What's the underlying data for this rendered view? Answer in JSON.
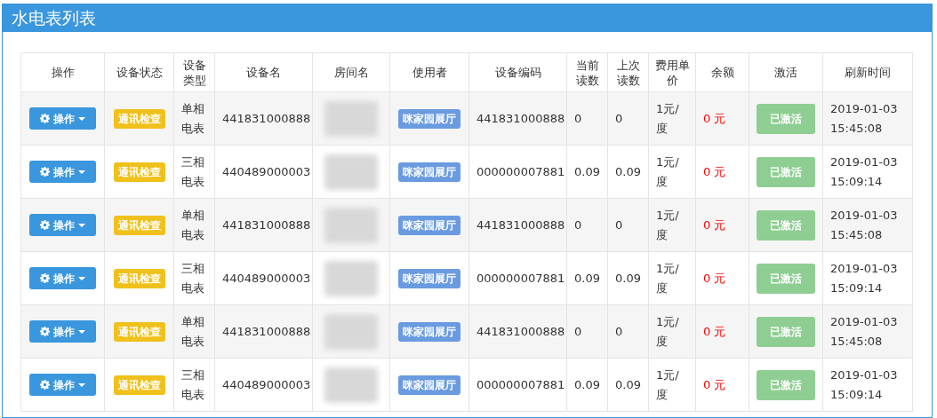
{
  "panel": {
    "title": "水电表列表"
  },
  "table": {
    "columns": [
      "操作",
      "设备状态",
      "设备类型",
      "设备名",
      "房间名",
      "使用者",
      "设备编码",
      "当前读数",
      "上次读数",
      "费用单价",
      "余额",
      "激活",
      "刷新时间"
    ],
    "rows": [
      {
        "action": "操作",
        "status": "通讯检查",
        "type": "单相电表",
        "device_name": "441831000888",
        "user": "咪家园展厅",
        "code": "441831000888",
        "current": "0",
        "previous": "0",
        "price": "1元/度",
        "balance": "0 元",
        "activate": "已激活",
        "refreshed": "2019-01-03 15:45:08"
      },
      {
        "action": "操作",
        "status": "通讯检查",
        "type": "三相电表",
        "device_name": "440489000003",
        "user": "咪家园展厅",
        "code": "000000007881",
        "current": "0.09",
        "previous": "0.09",
        "price": "1元/度",
        "balance": "0 元",
        "activate": "已激活",
        "refreshed": "2019-01-03 15:09:14"
      },
      {
        "action": "操作",
        "status": "通讯检查",
        "type": "单相电表",
        "device_name": "441831000888",
        "user": "咪家园展厅",
        "code": "441831000888",
        "current": "0",
        "previous": "0",
        "price": "1元/度",
        "balance": "0 元",
        "activate": "已激活",
        "refreshed": "2019-01-03 15:45:08"
      },
      {
        "action": "操作",
        "status": "通讯检查",
        "type": "三相电表",
        "device_name": "440489000003",
        "user": "咪家园展厅",
        "code": "000000007881",
        "current": "0.09",
        "previous": "0.09",
        "price": "1元/度",
        "balance": "0 元",
        "activate": "已激活",
        "refreshed": "2019-01-03 15:09:14"
      },
      {
        "action": "操作",
        "status": "通讯检查",
        "type": "单相电表",
        "device_name": "441831000888",
        "user": "咪家园展厅",
        "code": "441831000888",
        "current": "0",
        "previous": "0",
        "price": "1元/度",
        "balance": "0 元",
        "activate": "已激活",
        "refreshed": "2019-01-03 15:45:08"
      },
      {
        "action": "操作",
        "status": "通讯检查",
        "type": "三相电表",
        "device_name": "440489000003",
        "user": "咪家园展厅",
        "code": "000000007881",
        "current": "0.09",
        "previous": "0.09",
        "price": "1元/度",
        "balance": "0 元",
        "activate": "已激活",
        "refreshed": "2019-01-03 15:09:14"
      }
    ]
  }
}
